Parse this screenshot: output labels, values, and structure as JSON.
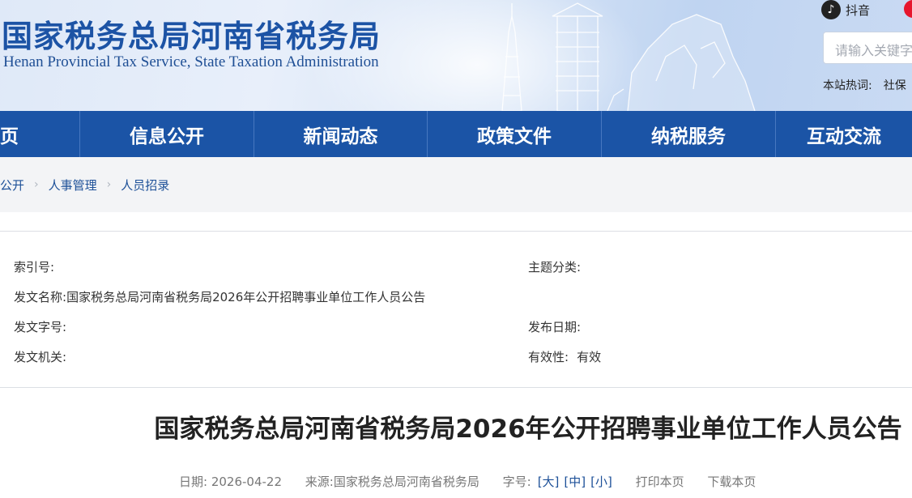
{
  "header": {
    "title_cn": "国家税务总局河南省税务局",
    "title_en": "Henan Provincial Tax Service, State Taxation Administration",
    "social": {
      "tiktok_icon": "tiktok-icon",
      "tiktok_label": "抖音",
      "weibo_icon": "weibo-icon"
    },
    "search": {
      "placeholder": "请输入关键字"
    },
    "hotwords": {
      "label": "本站热词:",
      "items": [
        "社保"
      ]
    }
  },
  "nav": {
    "items": [
      "页",
      "信息公开",
      "新闻动态",
      "政策文件",
      "纳税服务",
      "互动交流"
    ]
  },
  "breadcrumb": {
    "items": [
      "公开",
      "人事管理",
      "人员招录"
    ],
    "separator": "›"
  },
  "meta": {
    "index_no": {
      "label": "索引号:",
      "value": ""
    },
    "subject": {
      "label": "主题分类:",
      "value": ""
    },
    "doc_name": {
      "label": "发文名称:",
      "value": "国家税务总局河南省税务局2026年公开招聘事业单位工作人员公告"
    },
    "doc_no": {
      "label": "发文字号:",
      "value": ""
    },
    "publish_date": {
      "label": "发布日期:",
      "value": ""
    },
    "issuer": {
      "label": "发文机关:",
      "value": ""
    },
    "validity": {
      "label": "有效性:",
      "value": "有效"
    }
  },
  "article": {
    "title": "国家税务总局河南省税务局2026年公开招聘事业单位工作人员公告",
    "date": "日期:  2026-04-22",
    "source": "来源:国家税务总局河南省税务局",
    "font_label": "字号:",
    "font_large": "[大]",
    "font_medium": "[中]",
    "font_small": "[小]",
    "print": "打印本页",
    "download": "下载本页"
  },
  "colors": {
    "brand": "#1b54a6",
    "title": "#1c53a5",
    "crumb_bg": "#f3f4f6"
  }
}
